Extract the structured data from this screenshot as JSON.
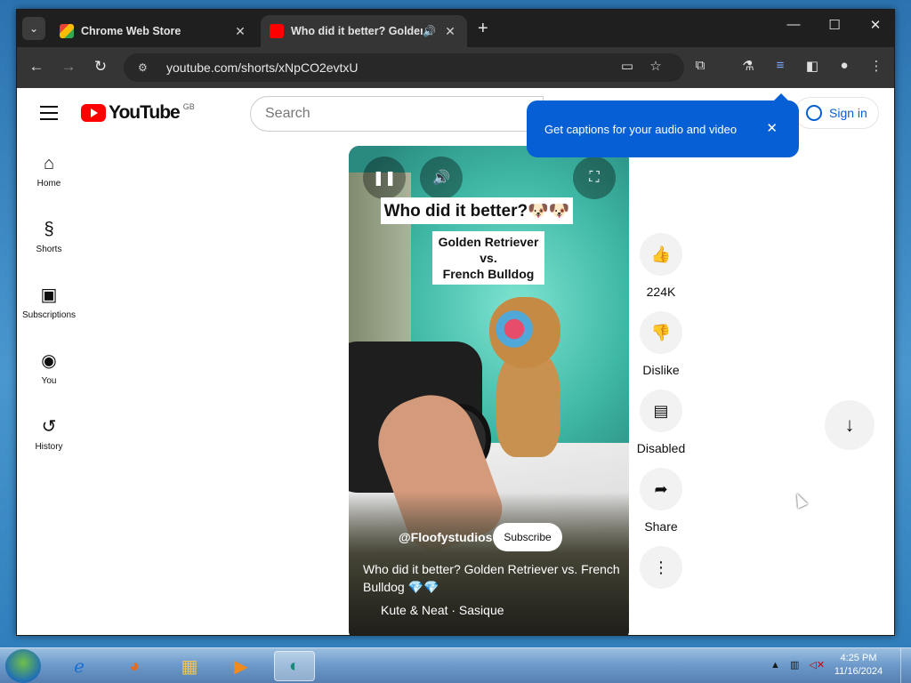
{
  "browser": {
    "tabs": [
      {
        "title": "Chrome Web Store",
        "active": false
      },
      {
        "title": "Who did it better? Golden",
        "active": true
      }
    ],
    "url": "youtube.com/shorts/xNpCO2evtxU"
  },
  "youtube": {
    "logo_text": "YouTube",
    "region": "GB",
    "search_placeholder": "Search",
    "signin_label": "Sign in",
    "tooltip_text": "Get captions for your audio and video",
    "sidebar": [
      {
        "label": "Home",
        "icon": "home-icon"
      },
      {
        "label": "Shorts",
        "icon": "shorts-icon"
      },
      {
        "label": "Subscriptions",
        "icon": "subscriptions-icon"
      },
      {
        "label": "You",
        "icon": "you-icon"
      },
      {
        "label": "History",
        "icon": "history-icon"
      }
    ],
    "short": {
      "overlay_title": "Who did it better?🐶🐶",
      "overlay_subtitle_1": "Golden Retriever",
      "overlay_subtitle_2": "vs.",
      "overlay_subtitle_3": "French Bulldog",
      "channel": "@Floofystudios",
      "subscribe_label": "Subscribe",
      "title": "Who did it better? Golden Retriever vs. French Bulldog 💎💎",
      "music": "Kute & Neat · Sasique"
    },
    "actions": {
      "like_count": "224K",
      "dislike_label": "Dislike",
      "comments_label": "Disabled",
      "share_label": "Share"
    }
  },
  "taskbar": {
    "time": "4:25 PM",
    "date": "11/16/2024"
  }
}
